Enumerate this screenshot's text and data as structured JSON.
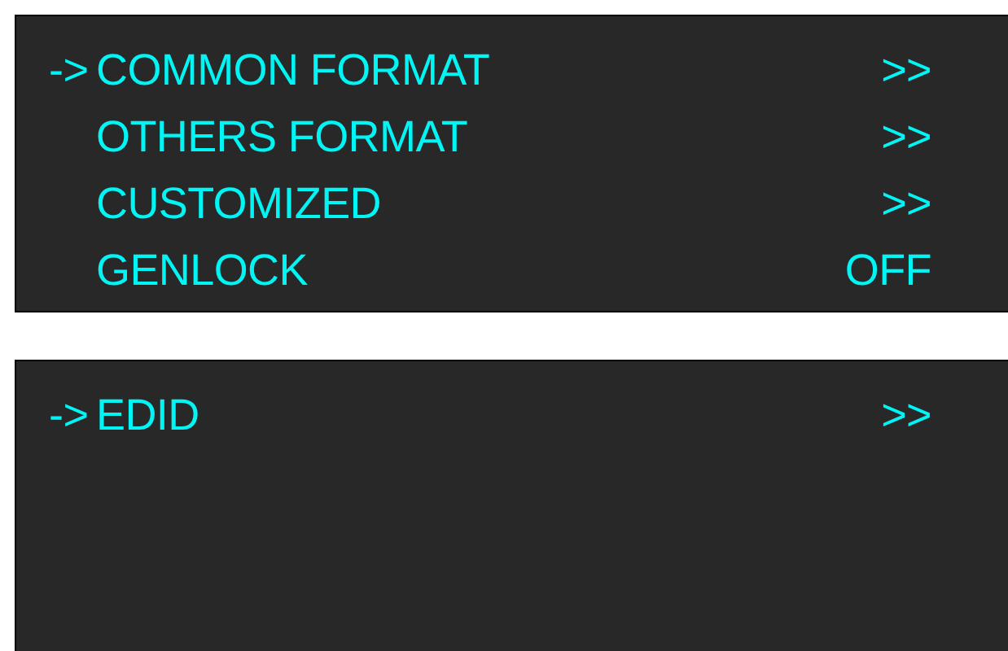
{
  "menus": [
    {
      "cursor": "->",
      "items": [
        {
          "label": "COMMON FORMAT",
          "value": ">>",
          "selected": true
        },
        {
          "label": "OTHERS FORMAT",
          "value": ">>",
          "selected": false
        },
        {
          "label": "CUSTOMIZED",
          "value": ">>",
          "selected": false
        },
        {
          "label": "GENLOCK",
          "value": "OFF",
          "selected": false
        }
      ]
    },
    {
      "cursor": "->",
      "items": [
        {
          "label": "EDID",
          "value": ">>",
          "selected": true
        }
      ]
    }
  ]
}
